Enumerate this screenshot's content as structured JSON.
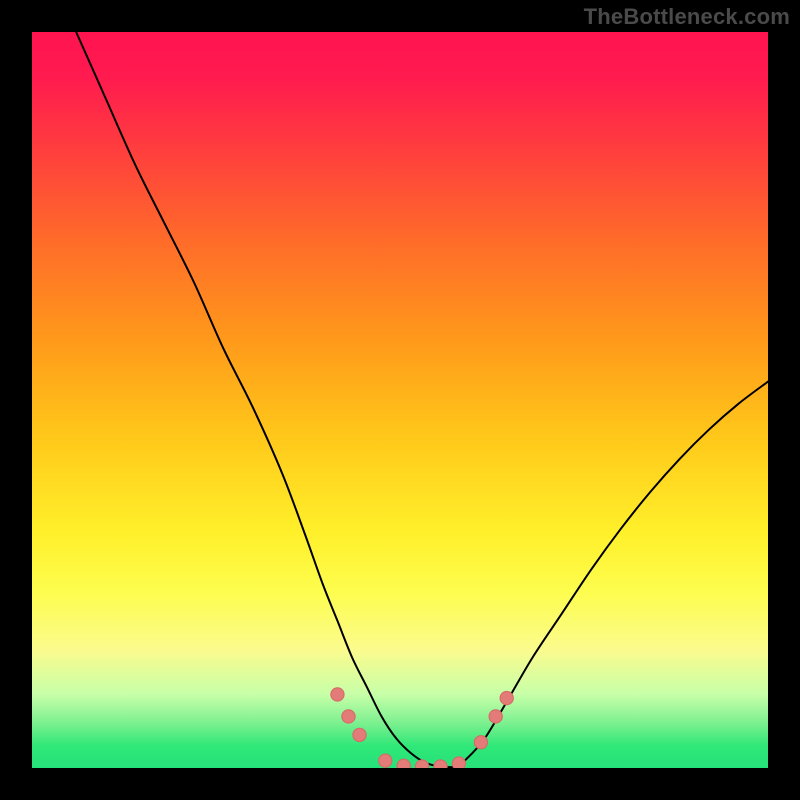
{
  "watermark": "TheBottleneck.com",
  "chart_data": {
    "type": "line",
    "title": "",
    "xlabel": "",
    "ylabel": "",
    "xlim": [
      0,
      100
    ],
    "ylim": [
      0,
      100
    ],
    "grid": false,
    "legend": false,
    "series": [
      {
        "name": "bottleneck-curve",
        "x": [
          6,
          10,
          14,
          18,
          22,
          26,
          30,
          34,
          37,
          39.5,
          41.5,
          43.5,
          45.5,
          47.5,
          49.5,
          51.5,
          53.5,
          55.5,
          57.5,
          59,
          61.5,
          64.5,
          68,
          72,
          76,
          80,
          84,
          88,
          92,
          96,
          100
        ],
        "values": [
          100,
          91,
          82,
          74,
          66,
          57,
          49,
          40,
          32,
          25,
          20,
          15,
          11,
          7,
          4,
          2,
          0.7,
          0.2,
          0.2,
          1.2,
          4,
          9,
          15,
          21,
          27,
          32.5,
          37.5,
          42,
          46,
          49.5,
          52.5
        ]
      }
    ],
    "markers": [
      {
        "name": "left-cluster-1",
        "x": 41.5,
        "y": 10,
        "r": 0.9
      },
      {
        "name": "left-cluster-2",
        "x": 43,
        "y": 7,
        "r": 0.9
      },
      {
        "name": "left-cluster-3",
        "x": 44.5,
        "y": 4.5,
        "r": 0.9
      },
      {
        "name": "bottom-a",
        "x": 48,
        "y": 1.0,
        "r": 0.9
      },
      {
        "name": "bottom-b",
        "x": 50.5,
        "y": 0.3,
        "r": 0.9
      },
      {
        "name": "bottom-c",
        "x": 53,
        "y": 0.2,
        "r": 0.9
      },
      {
        "name": "bottom-d",
        "x": 55.5,
        "y": 0.2,
        "r": 0.9
      },
      {
        "name": "bottom-e",
        "x": 58,
        "y": 0.6,
        "r": 0.9
      },
      {
        "name": "right-cluster-1",
        "x": 61,
        "y": 3.5,
        "r": 0.9
      },
      {
        "name": "right-cluster-2",
        "x": 63,
        "y": 7,
        "r": 0.9
      },
      {
        "name": "right-cluster-3",
        "x": 64.5,
        "y": 9.5,
        "r": 0.9
      }
    ],
    "colors": {
      "curve": "#000000",
      "marker_fill": "#e37c78",
      "marker_stroke": "#d66a66"
    }
  }
}
